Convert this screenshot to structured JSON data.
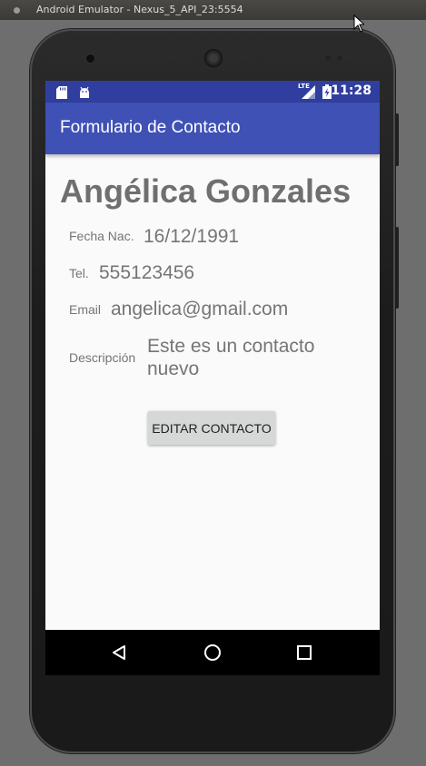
{
  "window": {
    "title": "Android Emulator - Nexus_5_API_23:5554"
  },
  "status_bar": {
    "time": "11:28",
    "network_label": "LTE",
    "left_icons": [
      "sd-card-icon",
      "android-icon"
    ],
    "right_icons": [
      "signal-icon",
      "battery-charging-icon"
    ],
    "color": "#303f9f"
  },
  "app_bar": {
    "title": "Formulario de Contacto",
    "color": "#3f51b5"
  },
  "contact": {
    "name": "Angélica Gonzales",
    "fields": {
      "birth_label": "Fecha Nac.",
      "birth_value": "16/12/1991",
      "phone_label": "Tel.",
      "phone_value": "555123456",
      "email_label": "Email",
      "email_value": "angelica@gmail.com",
      "description_label": "Descripción",
      "description_line1": "Este es un contacto",
      "description_line2": "nuevo"
    }
  },
  "actions": {
    "edit_label": "EDITAR CONTACTO"
  },
  "nav_bar": {
    "buttons": [
      "back-icon",
      "home-icon",
      "recents-icon"
    ]
  }
}
